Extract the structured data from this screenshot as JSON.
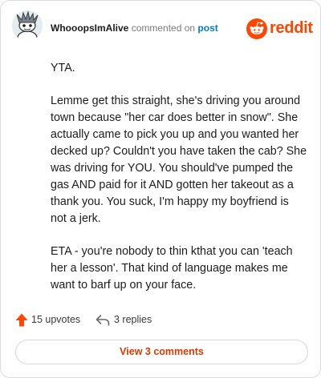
{
  "header": {
    "username": "WhooopsImAlive",
    "action_text": "commented on",
    "post_link": "post",
    "brand": "reddit"
  },
  "colors": {
    "brand": "#ff4500",
    "link": "#0079d3",
    "upvote": "#ff4500",
    "view_button_text": "#d93a00"
  },
  "icons": {
    "avatar": "snoo-avatar",
    "logo": "reddit-snoo-logo",
    "upvote": "upvote-arrow-icon",
    "reply": "reply-arrow-icon"
  },
  "comment": {
    "paragraphs": [
      "YTA.",
      "Lemme get this straight, she's driving you around town because \"her car does better in snow\". She actually came to pick you up and you wanted her decked up? Couldn't you have taken the cab? She was driving for YOU. You should've pumped the gas AND paid for it AND gotten her takeout as a thank you. You suck, I'm happy my boyfriend is not a jerk.",
      "ETA - you're nobody to thin kthat you can 'teach her a lesson'. That kind of language makes me want to barf up on your face."
    ]
  },
  "footer": {
    "upvotes_label": "15 upvotes",
    "replies_label": "3 replies",
    "view_comments_label": "View 3 comments"
  }
}
